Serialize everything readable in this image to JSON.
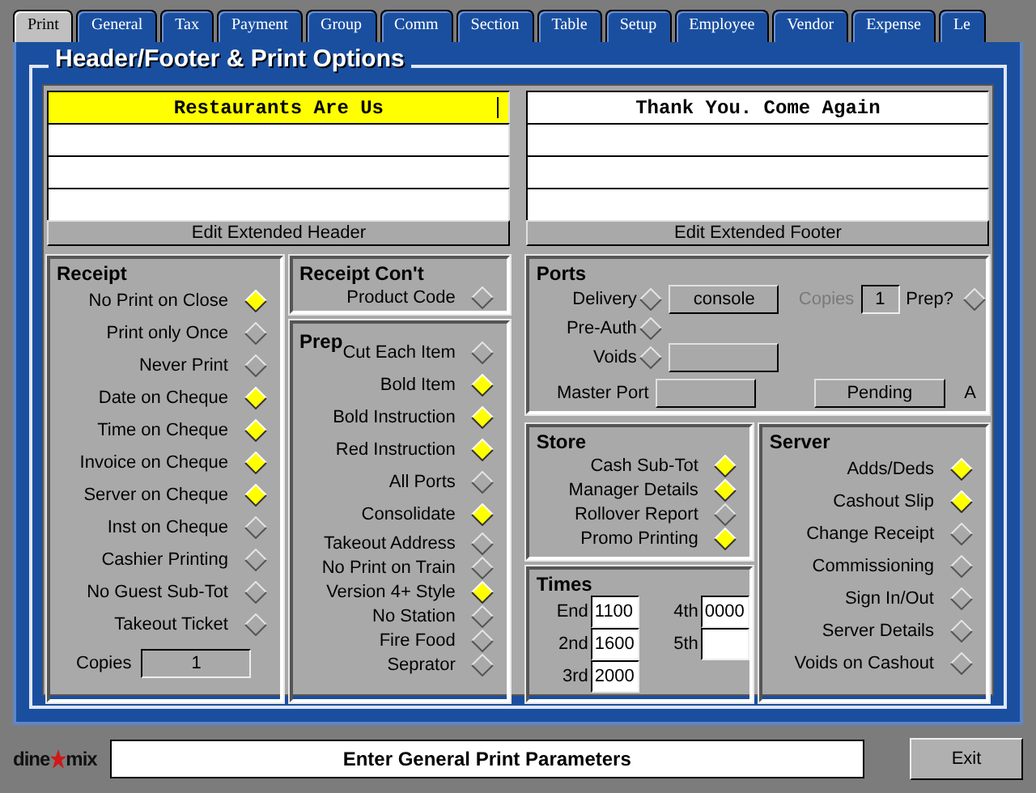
{
  "tabs": [
    {
      "label": "Print",
      "selected": true
    },
    {
      "label": "General",
      "selected": false
    },
    {
      "label": "Tax",
      "selected": false
    },
    {
      "label": "Payment",
      "selected": false
    },
    {
      "label": "Group",
      "selected": false
    },
    {
      "label": "Comm",
      "selected": false
    },
    {
      "label": "Section",
      "selected": false
    },
    {
      "label": "Table",
      "selected": false
    },
    {
      "label": "Setup",
      "selected": false
    },
    {
      "label": "Employee",
      "selected": false
    },
    {
      "label": "Vendor",
      "selected": false
    },
    {
      "label": "Expense",
      "selected": false
    },
    {
      "label": "Le",
      "selected": false
    }
  ],
  "panel_title": "Header/Footer & Print Options",
  "header": {
    "lines": [
      {
        "text": "Restaurants Are Us",
        "selected": true
      },
      {
        "selected": false
      },
      {
        "selected": false
      },
      {
        "selected": false
      }
    ],
    "button": "Edit Extended Header"
  },
  "footer": {
    "lines": [
      {
        "text": "Thank You. Come Again",
        "selected": false
      },
      {
        "selected": false
      },
      {
        "selected": false
      },
      {
        "selected": false
      }
    ],
    "button": "Edit Extended Footer"
  },
  "receipt": {
    "title": "Receipt",
    "options": [
      {
        "label": "No Print on Close",
        "checked": true
      },
      {
        "label": "Print only Once",
        "checked": false
      },
      {
        "label": "Never Print",
        "checked": false
      },
      {
        "label": "Date on Cheque",
        "checked": true
      },
      {
        "label": "Time on Cheque",
        "checked": true
      },
      {
        "label": "Invoice on Cheque",
        "checked": true
      },
      {
        "label": "Server on Cheque",
        "checked": true
      },
      {
        "label": "Inst on Cheque",
        "checked": false
      },
      {
        "label": "Cashier Printing",
        "checked": false
      },
      {
        "label": "No Guest Sub-Tot",
        "checked": false
      },
      {
        "label": "Takeout Ticket",
        "checked": false
      }
    ],
    "copies_label": "Copies",
    "copies_value": "1"
  },
  "receipt_cont": {
    "title": "Receipt Con't",
    "options": [
      {
        "label": "Product Code",
        "checked": false
      }
    ]
  },
  "prep": {
    "title": "Prep",
    "options": [
      {
        "label": "Cut Each Item",
        "checked": false
      },
      {
        "label": "Bold Item",
        "checked": true
      },
      {
        "label": "Bold Instruction",
        "checked": true
      },
      {
        "label": "Red Instruction",
        "checked": true
      },
      {
        "label": "All Ports",
        "checked": false
      },
      {
        "label": "Consolidate",
        "checked": true
      },
      {
        "label": "Takeout Address",
        "checked": false
      },
      {
        "label": "No Print on Train",
        "checked": false
      },
      {
        "label": "Version 4+ Style",
        "checked": true
      },
      {
        "label": "No Station",
        "checked": false
      },
      {
        "label": "Fire Food",
        "checked": false
      },
      {
        "label": "Seprator",
        "checked": false
      }
    ]
  },
  "ports": {
    "title": "Ports",
    "delivery": {
      "label": "Delivery",
      "checked": false,
      "port": "console"
    },
    "copies": {
      "label": "Copies",
      "value": "1",
      "disabled": true
    },
    "prep": {
      "label": "Prep?",
      "checked": false
    },
    "pre_auth": {
      "label": "Pre-Auth",
      "checked": false
    },
    "voids": {
      "label": "Voids",
      "checked": false
    },
    "master_port": {
      "label": "Master Port"
    },
    "pending_button": "Pending",
    "pending_flag": "A"
  },
  "store": {
    "title": "Store",
    "options": [
      {
        "label": "Cash Sub-Tot",
        "checked": true
      },
      {
        "label": "Manager Details",
        "checked": true
      },
      {
        "label": "Rollover Report",
        "checked": false
      },
      {
        "label": "Promo Printing",
        "checked": true
      }
    ]
  },
  "times": {
    "title": "Times",
    "fields": [
      {
        "label": "End",
        "value": "1100"
      },
      {
        "label": "4th",
        "value": "0000"
      },
      {
        "label": "2nd",
        "value": "1600"
      },
      {
        "label": "5th"
      },
      {
        "label": "3rd",
        "value": "2000"
      }
    ]
  },
  "server": {
    "title": "Server",
    "options": [
      {
        "label": "Adds/Deds",
        "checked": true
      },
      {
        "label": "Cashout Slip",
        "checked": true
      },
      {
        "label": "Change Receipt",
        "checked": false
      },
      {
        "label": "Commissioning",
        "checked": false
      },
      {
        "label": "Sign In/Out",
        "checked": false
      },
      {
        "label": "Server Details",
        "checked": false
      },
      {
        "label": "Voids on Cashout",
        "checked": false
      }
    ]
  },
  "logo": {
    "left": "dine",
    "right": "mix"
  },
  "status": {
    "message": "Enter General Print Parameters",
    "exit_button": "Exit"
  }
}
